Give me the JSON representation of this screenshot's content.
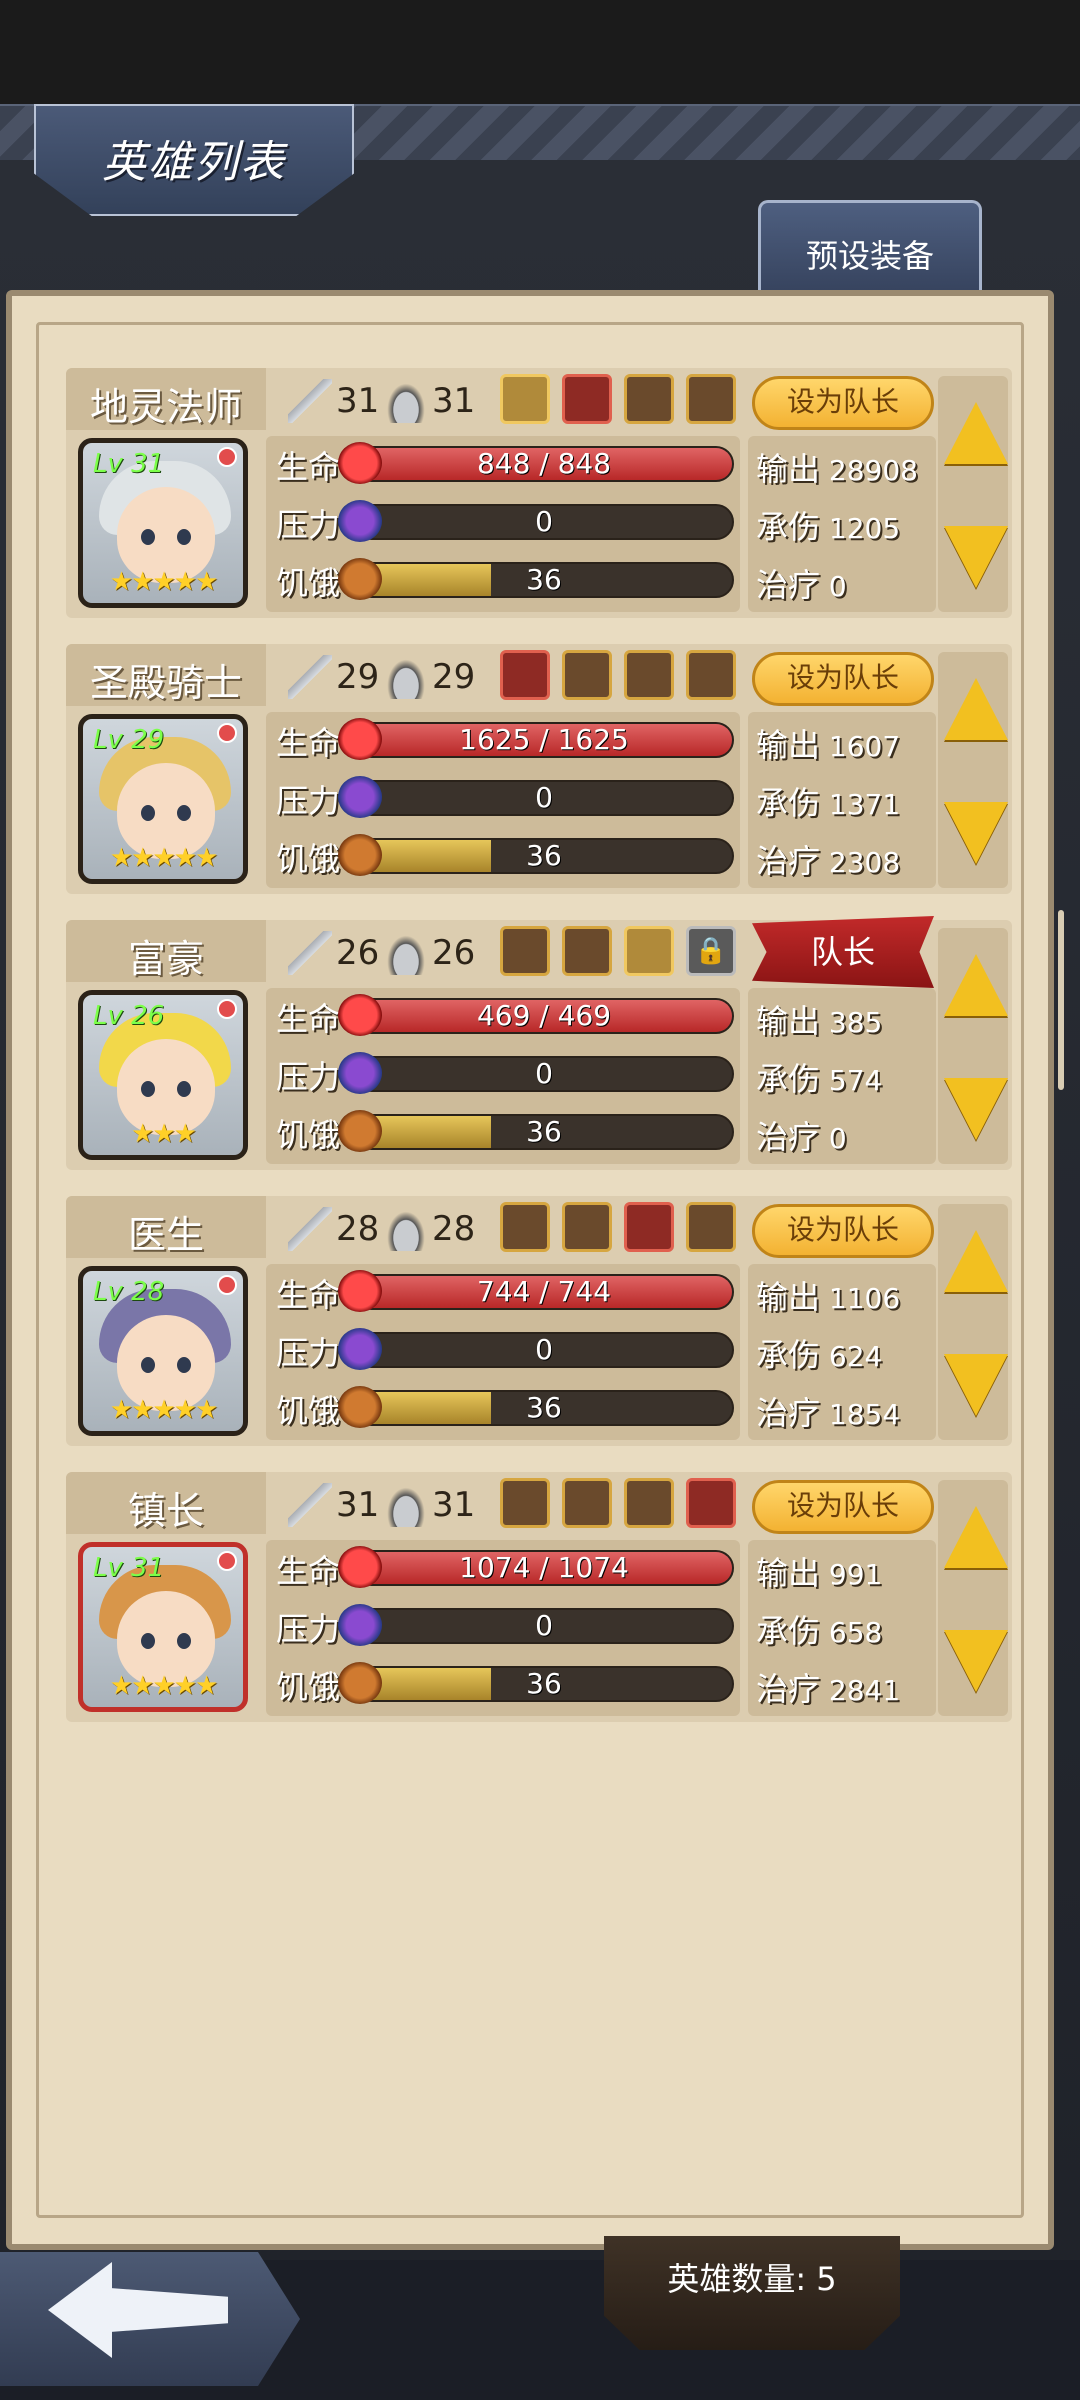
{
  "header": {
    "title": "英雄列表",
    "preset_button": "预设装备"
  },
  "heroes": [
    {
      "name": "地灵法师",
      "level": "Lv 31",
      "stars": "★★★★★",
      "attack": "31",
      "defense": "31",
      "equipment": [
        "wand-icon",
        "cross-swords-icon",
        "ring-icon",
        "cloak-icon"
      ],
      "leader": "设为队长",
      "is_leader": false,
      "hp_label": "生命",
      "hp": "848 / 848",
      "hp_fill": 1.0,
      "stress_label": "压力",
      "stress": "0",
      "stress_fill": 0,
      "hunger_label": "饥饿",
      "hunger": "36",
      "hunger_fill": 0.36,
      "out_label": "输出",
      "out": "28908",
      "tank_label": "承伤",
      "tank": "1205",
      "heal_label": "治疗",
      "heal": "0",
      "hair": "#dfe4e6"
    },
    {
      "name": "圣殿骑士",
      "level": "Lv 29",
      "stars": "★★★★★",
      "attack": "29",
      "defense": "29",
      "equipment": [
        "fire-gem-icon",
        "wings-icon",
        "shield-icon",
        "boot-icon"
      ],
      "leader": "设为队长",
      "is_leader": false,
      "hp_label": "生命",
      "hp": "1625 / 1625",
      "hp_fill": 1.0,
      "stress_label": "压力",
      "stress": "0",
      "stress_fill": 0,
      "hunger_label": "饥饿",
      "hunger": "36",
      "hunger_fill": 0.36,
      "out_label": "输出",
      "out": "1607",
      "tank_label": "承伤",
      "tank": "1371",
      "heal_label": "治疗",
      "heal": "2308",
      "hair": "#e6c468"
    },
    {
      "name": "富豪",
      "level": "Lv 26",
      "stars": "★★★",
      "attack": "26",
      "defense": "26",
      "equipment": [
        "coin-bag-icon",
        "cloak-icon",
        "backpack-icon",
        "lock-icon"
      ],
      "leader": "队长",
      "is_leader": true,
      "hp_label": "生命",
      "hp": "469 / 469",
      "hp_fill": 1.0,
      "stress_label": "压力",
      "stress": "0",
      "stress_fill": 0,
      "hunger_label": "饥饿",
      "hunger": "36",
      "hunger_fill": 0.36,
      "out_label": "输出",
      "out": "385",
      "tank_label": "承伤",
      "tank": "574",
      "heal_label": "治疗",
      "heal": "0",
      "hair": "#f2d84a"
    },
    {
      "name": "医生",
      "level": "Lv 28",
      "stars": "★★★★★",
      "attack": "28",
      "defense": "28",
      "equipment": [
        "spellbook-icon",
        "scroll-icon",
        "axe-icon",
        "shield-icon"
      ],
      "leader": "设为队长",
      "is_leader": false,
      "hp_label": "生命",
      "hp": "744 / 744",
      "hp_fill": 1.0,
      "stress_label": "压力",
      "stress": "0",
      "stress_fill": 0,
      "hunger_label": "饥饿",
      "hunger": "36",
      "hunger_fill": 0.36,
      "out_label": "输出",
      "out": "1106",
      "tank_label": "承伤",
      "tank": "624",
      "heal_label": "治疗",
      "heal": "1854",
      "hair": "#7a76a8"
    },
    {
      "name": "镇长",
      "level": "Lv 31",
      "stars": "★★★★★",
      "attack": "31",
      "defense": "31",
      "equipment": [
        "book-icon",
        "ring-icon",
        "helmet-icon",
        "witch-hat-icon"
      ],
      "leader": "设为队长",
      "is_leader": false,
      "hp_label": "生命",
      "hp": "1074 / 1074",
      "hp_fill": 1.0,
      "stress_label": "压力",
      "stress": "0",
      "stress_fill": 0,
      "hunger_label": "饥饿",
      "hunger": "36",
      "hunger_fill": 0.36,
      "out_label": "输出",
      "out": "991",
      "tank_label": "承伤",
      "tank": "658",
      "heal_label": "治疗",
      "heal": "2841",
      "hair": "#d8964a"
    }
  ],
  "footer": {
    "hero_count": "英雄数量: 5",
    "back_icon": "back-arrow-icon"
  }
}
